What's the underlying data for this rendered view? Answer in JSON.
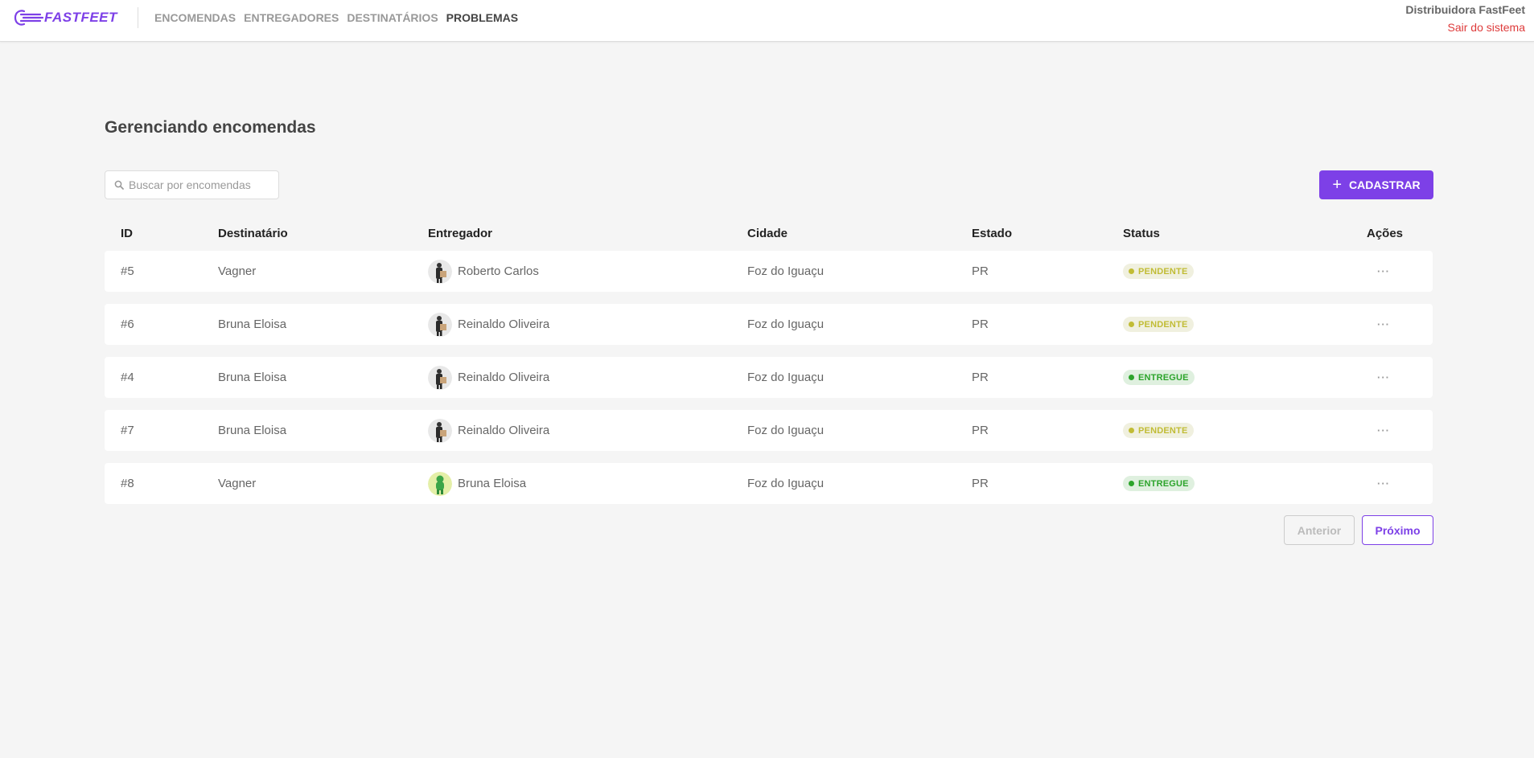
{
  "header": {
    "logo_text": "FASTFEET",
    "nav": [
      "ENCOMENDAS",
      "ENTREGADORES",
      "DESTINATÁRIOS",
      "PROBLEMAS"
    ],
    "active_nav": "PROBLEMAS",
    "user_name": "Distribuidora FastFeet",
    "logout_label": "Sair do sistema"
  },
  "main": {
    "title": "Gerenciando encomendas",
    "search_placeholder": "Buscar por encomendas",
    "add_button_label": "CADASTRAR",
    "columns": [
      "ID",
      "Destinatário",
      "Entregador",
      "Cidade",
      "Estado",
      "Status",
      "Ações"
    ],
    "rows": [
      {
        "id": "#5",
        "recipient": "Vagner",
        "deliveryman": "Roberto Carlos",
        "avatar": "courier-photo",
        "city": "Foz do Iguaçu",
        "state": "PR",
        "status": "PENDENTE",
        "actions": "···"
      },
      {
        "id": "#6",
        "recipient": "Bruna Eloisa",
        "deliveryman": "Reinaldo Oliveira",
        "avatar": "courier-photo",
        "city": "Foz do Iguaçu",
        "state": "PR",
        "status": "PENDENTE",
        "actions": "···"
      },
      {
        "id": "#4",
        "recipient": "Bruna Eloisa",
        "deliveryman": "Reinaldo Oliveira",
        "avatar": "courier-photo",
        "city": "Foz do Iguaçu",
        "state": "PR",
        "status": "ENTREGUE",
        "actions": "···"
      },
      {
        "id": "#7",
        "recipient": "Bruna Eloisa",
        "deliveryman": "Reinaldo Oliveira",
        "avatar": "courier-photo",
        "city": "Foz do Iguaçu",
        "state": "PR",
        "status": "PENDENTE",
        "actions": "···"
      },
      {
        "id": "#8",
        "recipient": "Vagner",
        "deliveryman": "Bruna Eloisa",
        "avatar": "green-figure-photo",
        "city": "Foz do Iguaçu",
        "state": "PR",
        "status": "ENTREGUE",
        "actions": "···"
      }
    ],
    "pagination": {
      "prev_label": "Anterior",
      "next_label": "Próximo"
    }
  },
  "colors": {
    "brand": "#7d40e7",
    "logout": "#de3b3b",
    "pendente": "#c1bc35",
    "pendente_bg": "#f0f0df",
    "entregue": "#2ca42b",
    "entregue_bg": "#dff0df"
  },
  "icons": {
    "logo": "speed-lines-truck-icon",
    "search": "search-icon",
    "add": "plus-icon"
  }
}
